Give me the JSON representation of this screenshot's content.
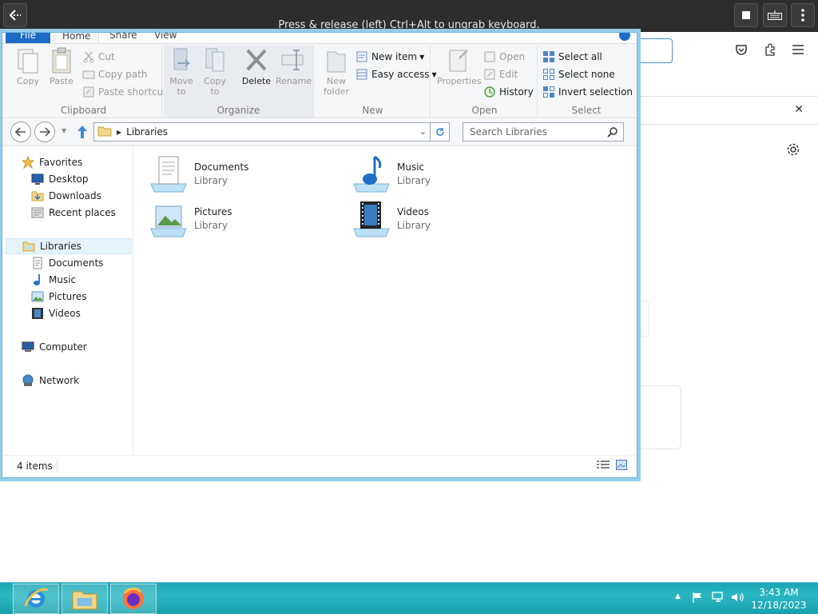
{
  "viewer": {
    "message": "Press & release (left) Ctrl+Alt to ungrab keyboard."
  },
  "ribbon": {
    "tabs": [
      "File",
      "Home",
      "Share",
      "View"
    ],
    "clipboard": {
      "copy": "Copy",
      "paste": "Paste",
      "cut": "Cut",
      "copy_path": "Copy path",
      "paste_shortcut": "Paste shortcut",
      "label": "Clipboard"
    },
    "organize": {
      "move_to": "Move\nto",
      "copy_to": "Copy\nto",
      "delete": "Delete",
      "rename": "Rename",
      "label": "Organize"
    },
    "new": {
      "new_folder": "New\nfolder",
      "new_item": "New item",
      "easy_access": "Easy access",
      "label": "New"
    },
    "open": {
      "properties": "Properties",
      "open": "Open",
      "edit": "Edit",
      "history": "History",
      "label": "Open"
    },
    "select": {
      "select_all": "Select all",
      "select_none": "Select none",
      "invert": "Invert selection",
      "label": "Select"
    }
  },
  "address": {
    "path": "Libraries",
    "search_placeholder": "Search Libraries"
  },
  "navpane": {
    "favorites": "Favorites",
    "desktop": "Desktop",
    "downloads": "Downloads",
    "recent": "Recent places",
    "libraries": "Libraries",
    "documents": "Documents",
    "music": "Music",
    "pictures": "Pictures",
    "videos": "Videos",
    "computer": "Computer",
    "network": "Network"
  },
  "libraries": [
    {
      "name": "Documents",
      "type": "Library"
    },
    {
      "name": "Music",
      "type": "Library"
    },
    {
      "name": "Pictures",
      "type": "Library"
    },
    {
      "name": "Videos",
      "type": "Library"
    }
  ],
  "status": {
    "count": "4 items"
  },
  "clock": {
    "time": "3:43 AM",
    "date": "12/18/2023"
  },
  "colors": {
    "accent": "#1c6bc4",
    "window_border": "#95cdeb",
    "taskbar": "#1aa4b2"
  }
}
